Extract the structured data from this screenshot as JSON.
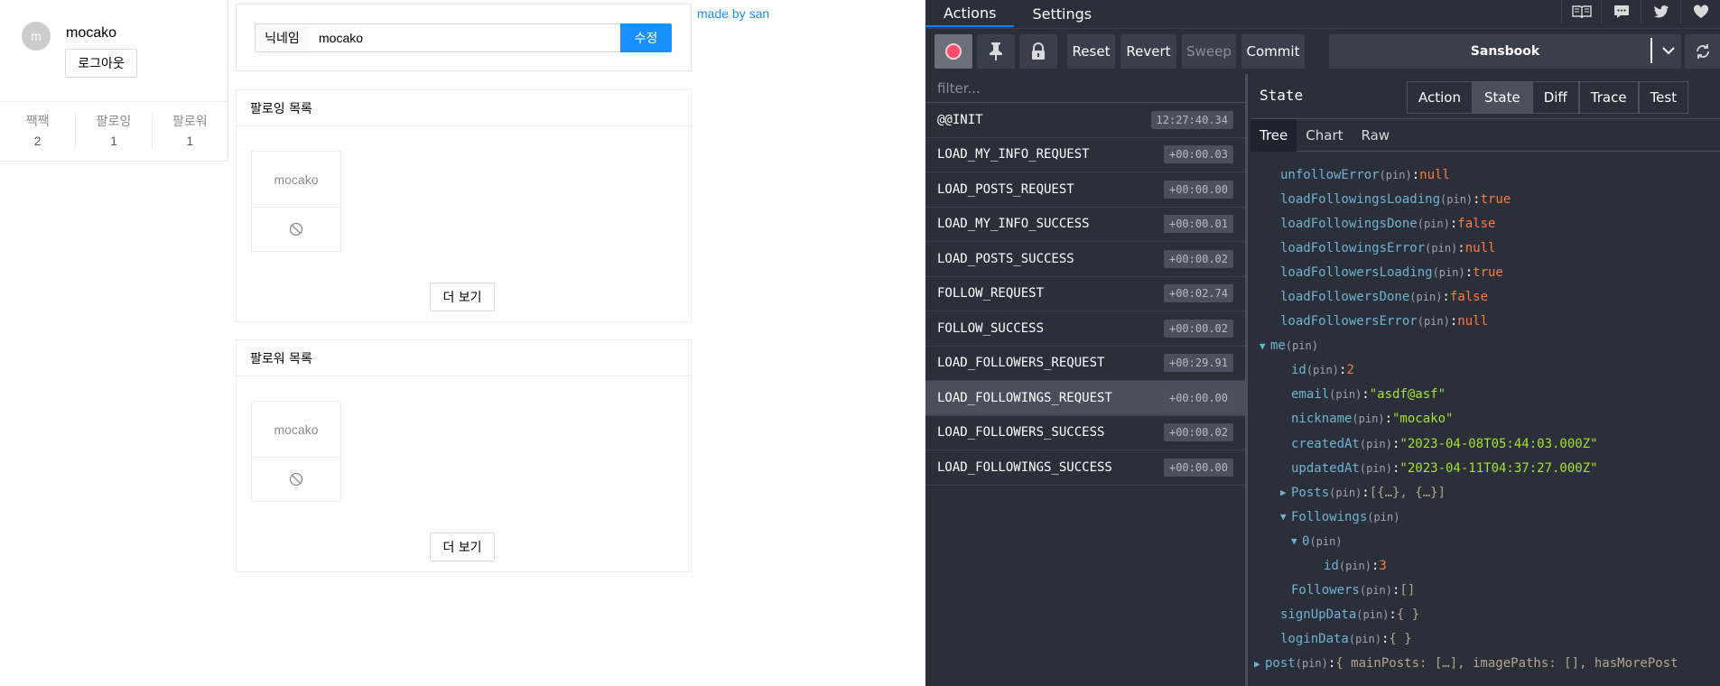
{
  "webapp": {
    "profile": {
      "avatar_letter": "m",
      "nickname": "mocako",
      "logout_label": "로그아웃",
      "stats": [
        {
          "label": "짹짹",
          "value": "2"
        },
        {
          "label": "팔로잉",
          "value": "1"
        },
        {
          "label": "팔로워",
          "value": "1"
        }
      ]
    },
    "nickname_form": {
      "addon_label": "닉네임",
      "value": "mocako",
      "submit_label": "수정"
    },
    "following": {
      "title": "팔로잉 목록",
      "users": [
        "mocako"
      ],
      "more_label": "더 보기"
    },
    "followers": {
      "title": "팔로워 목록",
      "users": [
        "mocako"
      ],
      "more_label": "더 보기"
    },
    "made_by": "made by san"
  },
  "devtools": {
    "tabs": [
      "Actions",
      "Settings"
    ],
    "top_icons": [
      "book-icon",
      "chat-icon",
      "twitter-icon",
      "heart-icon"
    ],
    "toolbar": {
      "reset": "Reset",
      "revert": "Revert",
      "sweep": "Sweep",
      "commit": "Commit",
      "instance": "Sansbook"
    },
    "filter_placeholder": "filter...",
    "actions": [
      {
        "name": "@@INIT",
        "time": "12:27:40.34"
      },
      {
        "name": "LOAD_MY_INFO_REQUEST",
        "time": "+00:00.03"
      },
      {
        "name": "LOAD_POSTS_REQUEST",
        "time": "+00:00.00"
      },
      {
        "name": "LOAD_MY_INFO_SUCCESS",
        "time": "+00:00.01"
      },
      {
        "name": "LOAD_POSTS_SUCCESS",
        "time": "+00:00.02"
      },
      {
        "name": "FOLLOW_REQUEST",
        "time": "+00:02.74"
      },
      {
        "name": "FOLLOW_SUCCESS",
        "time": "+00:00.02"
      },
      {
        "name": "LOAD_FOLLOWERS_REQUEST",
        "time": "+00:29.91"
      },
      {
        "name": "LOAD_FOLLOWINGS_REQUEST",
        "time": "+00:00.00",
        "selected": true
      },
      {
        "name": "LOAD_FOLLOWERS_SUCCESS",
        "time": "+00:00.02"
      },
      {
        "name": "LOAD_FOLLOWINGS_SUCCESS",
        "time": "+00:00.00"
      }
    ],
    "state_title": "State",
    "mode_tabs": [
      "Action",
      "State",
      "Diff",
      "Trace",
      "Test"
    ],
    "active_mode": "State",
    "sub_tabs": [
      "Tree",
      "Chart",
      "Raw"
    ],
    "pin_label": "(pin)",
    "tree": [
      {
        "indent": 0,
        "key": "unfollowError",
        "value": "null",
        "type": "null"
      },
      {
        "indent": 0,
        "key": "loadFollowingsLoading",
        "value": "true",
        "type": "bool"
      },
      {
        "indent": 0,
        "key": "loadFollowingsDone",
        "value": "false",
        "type": "bool"
      },
      {
        "indent": 0,
        "key": "loadFollowingsError",
        "value": "null",
        "type": "null"
      },
      {
        "indent": 0,
        "key": "loadFollowersLoading",
        "value": "true",
        "type": "bool"
      },
      {
        "indent": 0,
        "key": "loadFollowersDone",
        "value": "false",
        "type": "bool"
      },
      {
        "indent": 0,
        "key": "loadFollowersError",
        "value": "null",
        "type": "null"
      },
      {
        "indent": -1,
        "key": "me",
        "arrow": "▼",
        "value": "",
        "type": "none"
      },
      {
        "indent": 1,
        "key": "id",
        "value": "2",
        "type": "num"
      },
      {
        "indent": 1,
        "key": "email",
        "value": "\"asdf@asf\"",
        "type": "str"
      },
      {
        "indent": 1,
        "key": "nickname",
        "value": "\"mocako\"",
        "type": "str"
      },
      {
        "indent": 1,
        "key": "createdAt",
        "value": "\"2023-04-08T05:44:03.000Z\"",
        "type": "str"
      },
      {
        "indent": 1,
        "key": "updatedAt",
        "value": "\"2023-04-11T04:37:27.000Z\"",
        "type": "str"
      },
      {
        "indent": 0,
        "key": "Posts",
        "arrow": "▶",
        "value": "[{…}, {…}]",
        "type": "obj"
      },
      {
        "indent": 0,
        "key": "Followings",
        "arrow": "▼",
        "value": "",
        "type": "none"
      },
      {
        "indent": 1,
        "key": "0",
        "arrow": "▼",
        "value": "",
        "type": "none"
      },
      {
        "indent": 3,
        "key": "id",
        "value": "3",
        "type": "num"
      },
      {
        "indent": 1,
        "key": "Followers",
        "value": "[]",
        "type": "obj"
      },
      {
        "indent": 0,
        "key": "signUpData",
        "value": "{ }",
        "type": "obj"
      },
      {
        "indent": 0,
        "key": "loginData",
        "value": "{ }",
        "type": "obj"
      },
      {
        "indent": -2,
        "key": "post",
        "arrow": "▶",
        "value": "{ mainPosts: […], imagePaths: [], hasMorePost",
        "type": "obj"
      }
    ]
  }
}
